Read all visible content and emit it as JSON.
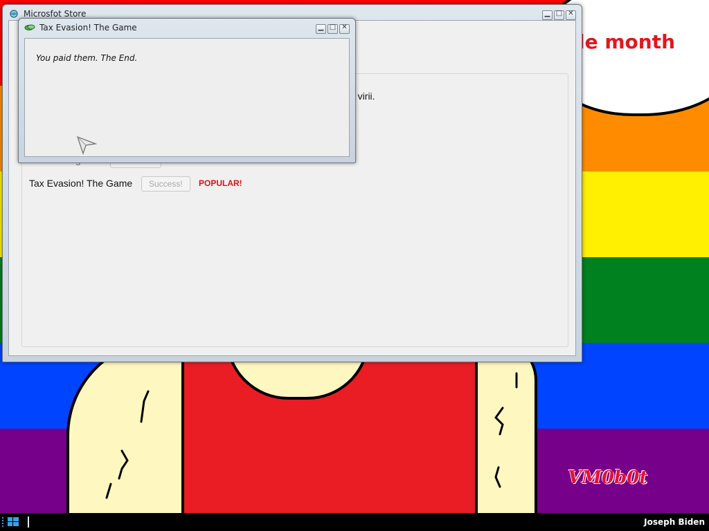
{
  "wallpaper": {
    "stripe_colors": [
      "#ff0000",
      "#ff8c00",
      "#ffef00",
      "#00811f",
      "#0044ff",
      "#760089"
    ],
    "bubble_text": "le month",
    "signature": "VM0b0t"
  },
  "store_window": {
    "title": "Microsfot Store",
    "icon": "store-globe-icon",
    "partial_text": "ns virii.",
    "hidden_row_text": "Scar Laleug?",
    "item": {
      "name": "Tax Evasion! The Game",
      "button_label": "Success!",
      "badge": "POPULAR!"
    }
  },
  "popup_window": {
    "title": "Tax Evasion! The Game",
    "icon": "money-icon",
    "message": "You paid them. The End."
  },
  "taskbar": {
    "start_icon": "windows-start-icon",
    "user_name": "Joseph Biden"
  },
  "colors": {
    "popular_red": "#e21010",
    "taskbar": "#000000"
  }
}
